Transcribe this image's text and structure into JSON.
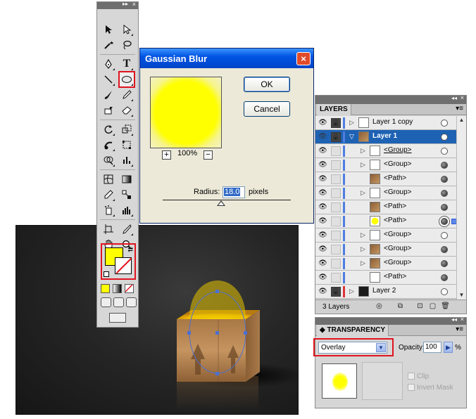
{
  "tools_panel": {
    "collapse_glyph": "▸▸",
    "close_glyph": "×",
    "rows": [
      [
        "selection-tool",
        "direct-selection-tool"
      ],
      [
        "magic-wand-tool",
        "lasso-tool"
      ],
      [
        "pen-tool",
        "type-tool"
      ],
      [
        "line-segment-tool",
        "ellipse-tool"
      ],
      [
        "paintbrush-tool",
        "pencil-tool"
      ],
      [
        "blob-brush-tool",
        "eraser-tool"
      ],
      [
        "rotate-tool",
        "scale-tool"
      ],
      [
        "warp-tool",
        "free-transform-tool"
      ],
      [
        "shape-builder-tool",
        "graph-tool"
      ],
      [
        "mesh-tool",
        "gradient-tool"
      ],
      [
        "eyedropper-tool",
        "blend-tool"
      ],
      [
        "symbol-sprayer-tool",
        "column-graph-tool"
      ],
      [
        "artboard-tool",
        "slice-tool"
      ],
      [
        "hand-tool",
        "zoom-tool"
      ]
    ],
    "type_glyph": "T",
    "fill_color": "#ffff00",
    "accent_red": "#e0141e"
  },
  "gaussian_blur": {
    "title": "Gaussian Blur",
    "close_glyph": "×",
    "ok_label": "OK",
    "cancel_label": "Cancel",
    "zoom_minus": "+",
    "zoom_plus": "−",
    "zoom_level": "100%",
    "radius_label": "Radius:",
    "radius_value": "18.0",
    "radius_unit": "pixels"
  },
  "layers_panel": {
    "tab_label": "LAYERS",
    "menu_glyph": "▾≡",
    "collapse_glyph": "◂◂",
    "close_glyph": "×",
    "count_label": "3 Layers",
    "rows": [
      {
        "name": "Layer 1 copy",
        "indent": 0,
        "expander": "▷",
        "thumb": "white",
        "target": "empty",
        "active": false,
        "color": "blue",
        "bold": false
      },
      {
        "name": "Layer 1",
        "indent": 0,
        "expander": "▽",
        "thumb": "photo",
        "target": "empty",
        "active": true,
        "color": "blue",
        "bold": true
      },
      {
        "name": "<Group>",
        "indent": 1,
        "expander": "▷",
        "thumb": "white",
        "target": "empty",
        "active": false,
        "color": "blue",
        "bold": false,
        "underline": true
      },
      {
        "name": "<Group>",
        "indent": 1,
        "expander": "▷",
        "thumb": "white",
        "target": "filled",
        "active": false,
        "color": "blue",
        "bold": false
      },
      {
        "name": "<Path>",
        "indent": 1,
        "expander": "",
        "thumb": "photo",
        "target": "filled",
        "active": false,
        "color": "blue",
        "bold": false
      },
      {
        "name": "<Group>",
        "indent": 1,
        "expander": "▷",
        "thumb": "white",
        "target": "filled",
        "active": false,
        "color": "blue",
        "bold": false
      },
      {
        "name": "<Path>",
        "indent": 1,
        "expander": "",
        "thumb": "photo",
        "target": "filled",
        "active": false,
        "color": "blue",
        "bold": false
      },
      {
        "name": "<Path>",
        "indent": 1,
        "expander": "",
        "thumb": "yellow",
        "target": "double",
        "active": false,
        "color": "blue",
        "bold": false,
        "selected": true
      },
      {
        "name": "<Group>",
        "indent": 1,
        "expander": "▷",
        "thumb": "white",
        "target": "empty",
        "active": false,
        "color": "blue",
        "bold": false
      },
      {
        "name": "<Group>",
        "indent": 1,
        "expander": "▷",
        "thumb": "photo",
        "target": "filled",
        "active": false,
        "color": "blue",
        "bold": false
      },
      {
        "name": "<Group>",
        "indent": 1,
        "expander": "▷",
        "thumb": "photo",
        "target": "filled",
        "active": false,
        "color": "blue",
        "bold": false
      },
      {
        "name": "<Path>",
        "indent": 1,
        "expander": "",
        "thumb": "white",
        "target": "filled",
        "active": false,
        "color": "blue",
        "bold": false
      },
      {
        "name": "Layer 2",
        "indent": 0,
        "expander": "▷",
        "thumb": "dark",
        "target": "empty",
        "active": false,
        "color": "red",
        "bold": false
      }
    ]
  },
  "transparency_panel": {
    "tab_label": "TRANSPARENCY",
    "menu_glyph": "▾≡",
    "collapse_glyph": "◂◂",
    "close_glyph": "×",
    "blend_mode": "Overlay",
    "opacity_label": "Opacity:",
    "opacity_value": "100",
    "opacity_unit": "%",
    "clip_label": "Clip",
    "invert_mask_label": "Invert Mask"
  }
}
